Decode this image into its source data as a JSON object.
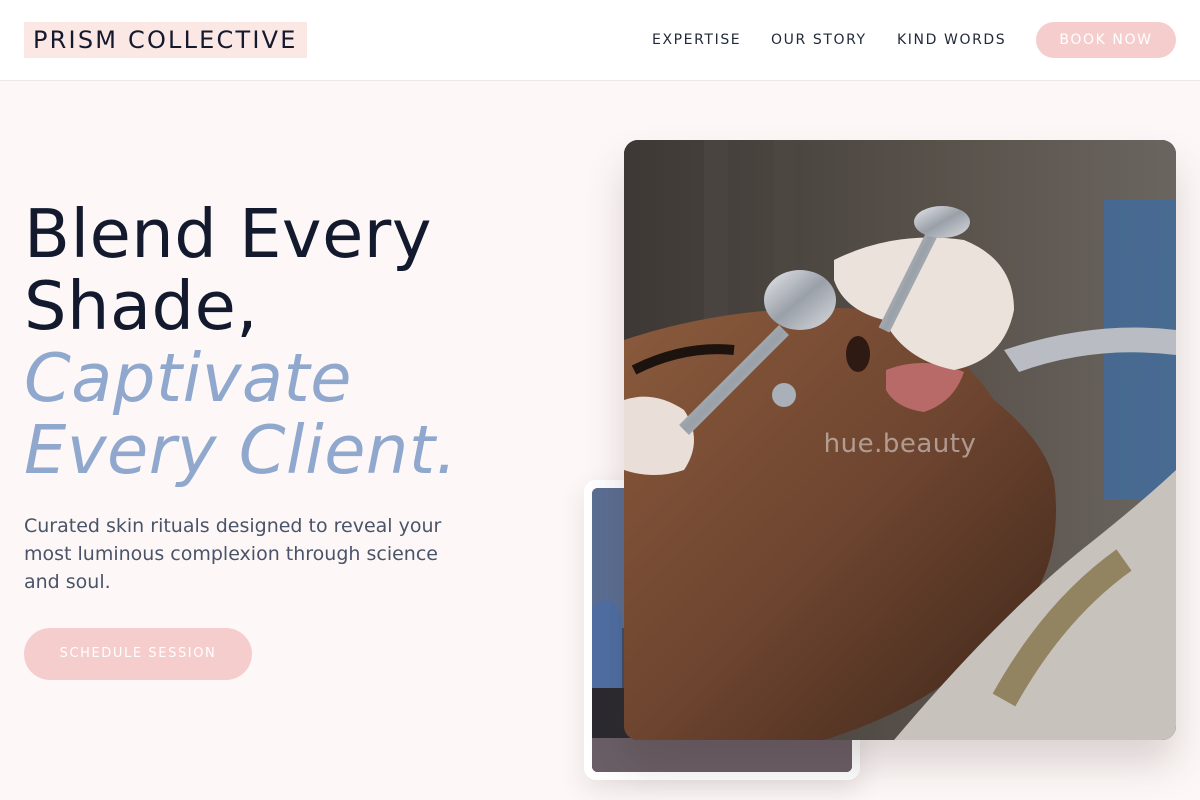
{
  "brand": {
    "logo": "PRISM COLLECTIVE"
  },
  "nav": {
    "links": [
      "EXPERTISE",
      "OUR STORY",
      "KIND WORDS"
    ],
    "cta": "BOOK NOW"
  },
  "hero": {
    "title_line1": "Blend Every",
    "title_line2": "Shade,",
    "accent_line1": "Captivate",
    "accent_line2": "Every Client.",
    "subtitle": "Curated skin rituals designed to reveal your most luminous complexion through science and soul.",
    "cta": "SCHEDULE SESSION"
  },
  "media": {
    "main_photo": "facial-treatment-photo",
    "secondary_photo": "client-portrait-photo",
    "watermark": "hue.beauty"
  },
  "colors": {
    "accent": "#90a8cd",
    "button": "#f6cdcd",
    "logo_bg": "#fbe7e4",
    "ink": "#141a2e",
    "background": "#fdf8f7"
  }
}
